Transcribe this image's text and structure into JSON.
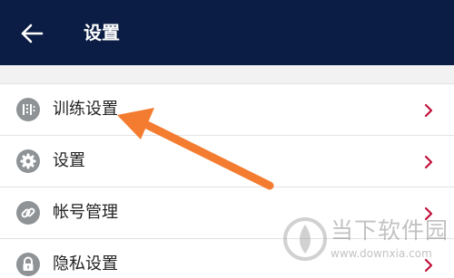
{
  "header": {
    "title": "设置",
    "back_icon": "arrow-left-icon",
    "background": "#0b1d44"
  },
  "settings": {
    "items": [
      {
        "label": "训练设置",
        "icon": "bars-icon"
      },
      {
        "label": "设置",
        "icon": "gear-icon"
      },
      {
        "label": "帐号管理",
        "icon": "link-icon"
      },
      {
        "label": "隐私设置",
        "icon": "lock-icon"
      }
    ],
    "chevron_color": "#c0123c"
  },
  "annotation": {
    "arrow_color": "#f47c30"
  },
  "watermark": {
    "title": "当下软件园",
    "url": "www.downxia.com"
  }
}
